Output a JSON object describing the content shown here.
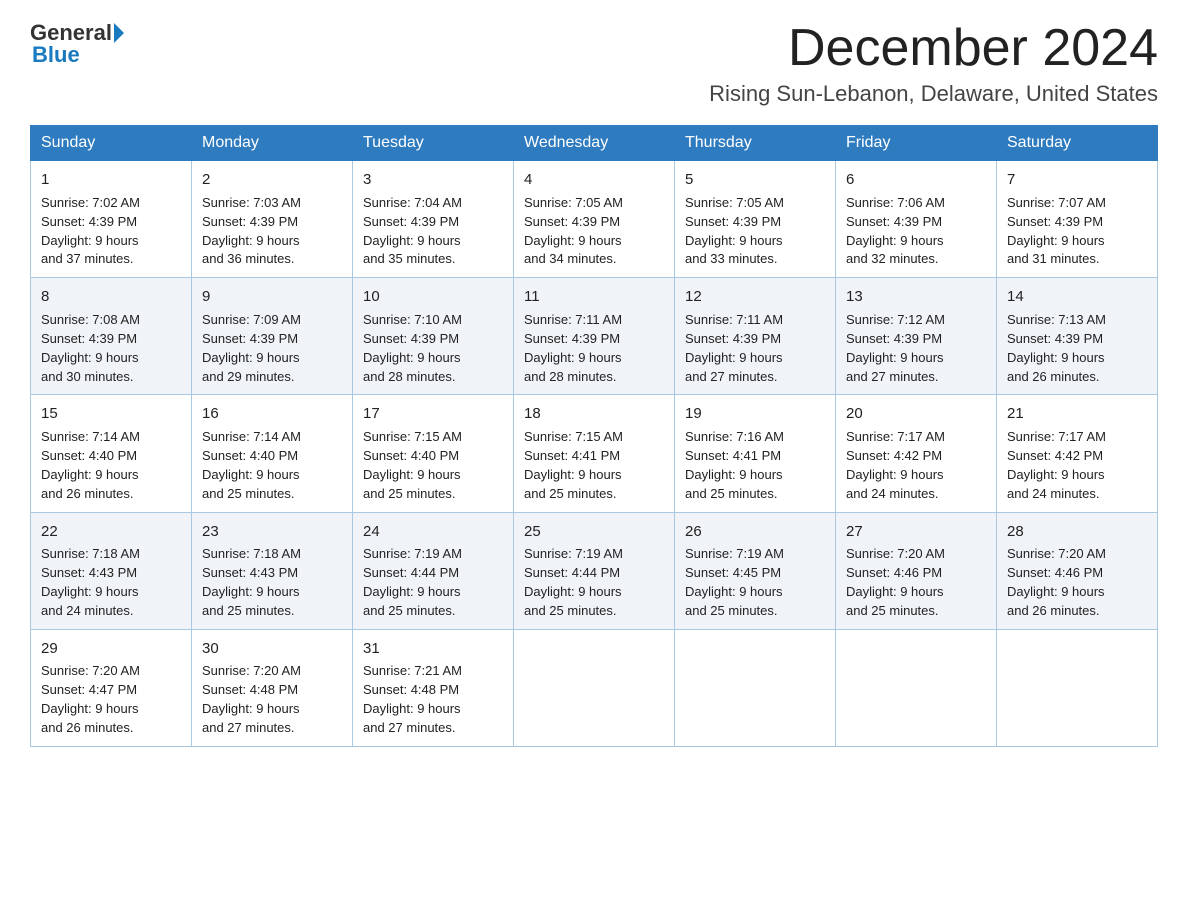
{
  "logo": {
    "general": "General",
    "triangle": "",
    "blue": "Blue"
  },
  "title": "December 2024",
  "subtitle": "Rising Sun-Lebanon, Delaware, United States",
  "days_of_week": [
    "Sunday",
    "Monday",
    "Tuesday",
    "Wednesday",
    "Thursday",
    "Friday",
    "Saturday"
  ],
  "weeks": [
    [
      {
        "num": "1",
        "sunrise": "Sunrise: 7:02 AM",
        "sunset": "Sunset: 4:39 PM",
        "daylight": "Daylight: 9 hours",
        "minutes": "and 37 minutes."
      },
      {
        "num": "2",
        "sunrise": "Sunrise: 7:03 AM",
        "sunset": "Sunset: 4:39 PM",
        "daylight": "Daylight: 9 hours",
        "minutes": "and 36 minutes."
      },
      {
        "num": "3",
        "sunrise": "Sunrise: 7:04 AM",
        "sunset": "Sunset: 4:39 PM",
        "daylight": "Daylight: 9 hours",
        "minutes": "and 35 minutes."
      },
      {
        "num": "4",
        "sunrise": "Sunrise: 7:05 AM",
        "sunset": "Sunset: 4:39 PM",
        "daylight": "Daylight: 9 hours",
        "minutes": "and 34 minutes."
      },
      {
        "num": "5",
        "sunrise": "Sunrise: 7:05 AM",
        "sunset": "Sunset: 4:39 PM",
        "daylight": "Daylight: 9 hours",
        "minutes": "and 33 minutes."
      },
      {
        "num": "6",
        "sunrise": "Sunrise: 7:06 AM",
        "sunset": "Sunset: 4:39 PM",
        "daylight": "Daylight: 9 hours",
        "minutes": "and 32 minutes."
      },
      {
        "num": "7",
        "sunrise": "Sunrise: 7:07 AM",
        "sunset": "Sunset: 4:39 PM",
        "daylight": "Daylight: 9 hours",
        "minutes": "and 31 minutes."
      }
    ],
    [
      {
        "num": "8",
        "sunrise": "Sunrise: 7:08 AM",
        "sunset": "Sunset: 4:39 PM",
        "daylight": "Daylight: 9 hours",
        "minutes": "and 30 minutes."
      },
      {
        "num": "9",
        "sunrise": "Sunrise: 7:09 AM",
        "sunset": "Sunset: 4:39 PM",
        "daylight": "Daylight: 9 hours",
        "minutes": "and 29 minutes."
      },
      {
        "num": "10",
        "sunrise": "Sunrise: 7:10 AM",
        "sunset": "Sunset: 4:39 PM",
        "daylight": "Daylight: 9 hours",
        "minutes": "and 28 minutes."
      },
      {
        "num": "11",
        "sunrise": "Sunrise: 7:11 AM",
        "sunset": "Sunset: 4:39 PM",
        "daylight": "Daylight: 9 hours",
        "minutes": "and 28 minutes."
      },
      {
        "num": "12",
        "sunrise": "Sunrise: 7:11 AM",
        "sunset": "Sunset: 4:39 PM",
        "daylight": "Daylight: 9 hours",
        "minutes": "and 27 minutes."
      },
      {
        "num": "13",
        "sunrise": "Sunrise: 7:12 AM",
        "sunset": "Sunset: 4:39 PM",
        "daylight": "Daylight: 9 hours",
        "minutes": "and 27 minutes."
      },
      {
        "num": "14",
        "sunrise": "Sunrise: 7:13 AM",
        "sunset": "Sunset: 4:39 PM",
        "daylight": "Daylight: 9 hours",
        "minutes": "and 26 minutes."
      }
    ],
    [
      {
        "num": "15",
        "sunrise": "Sunrise: 7:14 AM",
        "sunset": "Sunset: 4:40 PM",
        "daylight": "Daylight: 9 hours",
        "minutes": "and 26 minutes."
      },
      {
        "num": "16",
        "sunrise": "Sunrise: 7:14 AM",
        "sunset": "Sunset: 4:40 PM",
        "daylight": "Daylight: 9 hours",
        "minutes": "and 25 minutes."
      },
      {
        "num": "17",
        "sunrise": "Sunrise: 7:15 AM",
        "sunset": "Sunset: 4:40 PM",
        "daylight": "Daylight: 9 hours",
        "minutes": "and 25 minutes."
      },
      {
        "num": "18",
        "sunrise": "Sunrise: 7:15 AM",
        "sunset": "Sunset: 4:41 PM",
        "daylight": "Daylight: 9 hours",
        "minutes": "and 25 minutes."
      },
      {
        "num": "19",
        "sunrise": "Sunrise: 7:16 AM",
        "sunset": "Sunset: 4:41 PM",
        "daylight": "Daylight: 9 hours",
        "minutes": "and 25 minutes."
      },
      {
        "num": "20",
        "sunrise": "Sunrise: 7:17 AM",
        "sunset": "Sunset: 4:42 PM",
        "daylight": "Daylight: 9 hours",
        "minutes": "and 24 minutes."
      },
      {
        "num": "21",
        "sunrise": "Sunrise: 7:17 AM",
        "sunset": "Sunset: 4:42 PM",
        "daylight": "Daylight: 9 hours",
        "minutes": "and 24 minutes."
      }
    ],
    [
      {
        "num": "22",
        "sunrise": "Sunrise: 7:18 AM",
        "sunset": "Sunset: 4:43 PM",
        "daylight": "Daylight: 9 hours",
        "minutes": "and 24 minutes."
      },
      {
        "num": "23",
        "sunrise": "Sunrise: 7:18 AM",
        "sunset": "Sunset: 4:43 PM",
        "daylight": "Daylight: 9 hours",
        "minutes": "and 25 minutes."
      },
      {
        "num": "24",
        "sunrise": "Sunrise: 7:19 AM",
        "sunset": "Sunset: 4:44 PM",
        "daylight": "Daylight: 9 hours",
        "minutes": "and 25 minutes."
      },
      {
        "num": "25",
        "sunrise": "Sunrise: 7:19 AM",
        "sunset": "Sunset: 4:44 PM",
        "daylight": "Daylight: 9 hours",
        "minutes": "and 25 minutes."
      },
      {
        "num": "26",
        "sunrise": "Sunrise: 7:19 AM",
        "sunset": "Sunset: 4:45 PM",
        "daylight": "Daylight: 9 hours",
        "minutes": "and 25 minutes."
      },
      {
        "num": "27",
        "sunrise": "Sunrise: 7:20 AM",
        "sunset": "Sunset: 4:46 PM",
        "daylight": "Daylight: 9 hours",
        "minutes": "and 25 minutes."
      },
      {
        "num": "28",
        "sunrise": "Sunrise: 7:20 AM",
        "sunset": "Sunset: 4:46 PM",
        "daylight": "Daylight: 9 hours",
        "minutes": "and 26 minutes."
      }
    ],
    [
      {
        "num": "29",
        "sunrise": "Sunrise: 7:20 AM",
        "sunset": "Sunset: 4:47 PM",
        "daylight": "Daylight: 9 hours",
        "minutes": "and 26 minutes."
      },
      {
        "num": "30",
        "sunrise": "Sunrise: 7:20 AM",
        "sunset": "Sunset: 4:48 PM",
        "daylight": "Daylight: 9 hours",
        "minutes": "and 27 minutes."
      },
      {
        "num": "31",
        "sunrise": "Sunrise: 7:21 AM",
        "sunset": "Sunset: 4:48 PM",
        "daylight": "Daylight: 9 hours",
        "minutes": "and 27 minutes."
      },
      null,
      null,
      null,
      null
    ]
  ]
}
